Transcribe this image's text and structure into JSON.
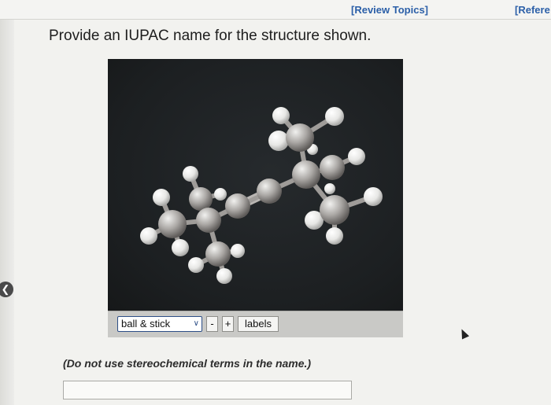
{
  "header": {
    "review_topics": "[Review Topics]",
    "references": "[Refere"
  },
  "question": {
    "text": "Provide an IUPAC name for the structure shown."
  },
  "viewer": {
    "display_mode": "ball & stick",
    "minus_label": "-",
    "plus_label": "+",
    "labels_button": "labels"
  },
  "note": "(Do not use stereochemical terms in the name.)",
  "answer": {
    "value": ""
  },
  "collapse_icon": "chevron-left-icon"
}
